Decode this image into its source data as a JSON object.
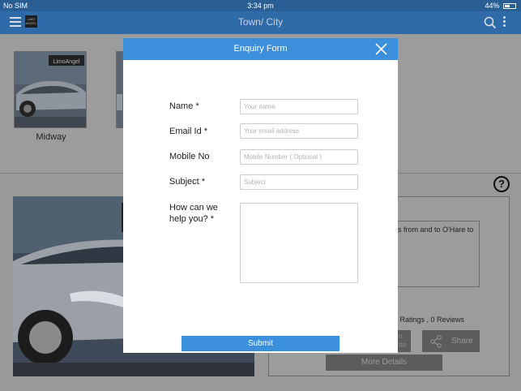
{
  "status_bar": {
    "carrier": "No SIM",
    "time": "3:34 pm",
    "battery": "44%"
  },
  "header": {
    "title": "Town/ City",
    "logo_text": "LIMO ANGEL",
    "icons": [
      "menu-icon",
      "search-icon",
      "more-vertical-icon"
    ]
  },
  "background": {
    "thumbnail_label": "Midway",
    "thumbnail_plate": "LimoAngel",
    "description_snippet": "s from and to O'Hare to",
    "ratings_text": "0 Ratings , 0 Reviews",
    "favorite_partial": "to rite",
    "share_label": "Share",
    "more_details_label": "More Details",
    "help_glyph": "?"
  },
  "modal": {
    "title": "Enquiry Form",
    "fields": {
      "name": {
        "label": "Name *",
        "placeholder": "Your name"
      },
      "email": {
        "label": "Email Id *",
        "placeholder": "Your email address"
      },
      "mobile": {
        "label": "Mobile No",
        "placeholder": "Mobile Number ( Optional )"
      },
      "subject": {
        "label": "Subject *",
        "placeholder": "Subject"
      },
      "message": {
        "label_line1": "How can we",
        "label_line2": "help you? *",
        "value": ""
      }
    },
    "submit_label": "Submit"
  },
  "colors": {
    "status_bar": "#2a5f96",
    "header": "#2f6ba8",
    "modal_accent": "#3b8fdb",
    "overlay_background": "#9a9a9a"
  }
}
